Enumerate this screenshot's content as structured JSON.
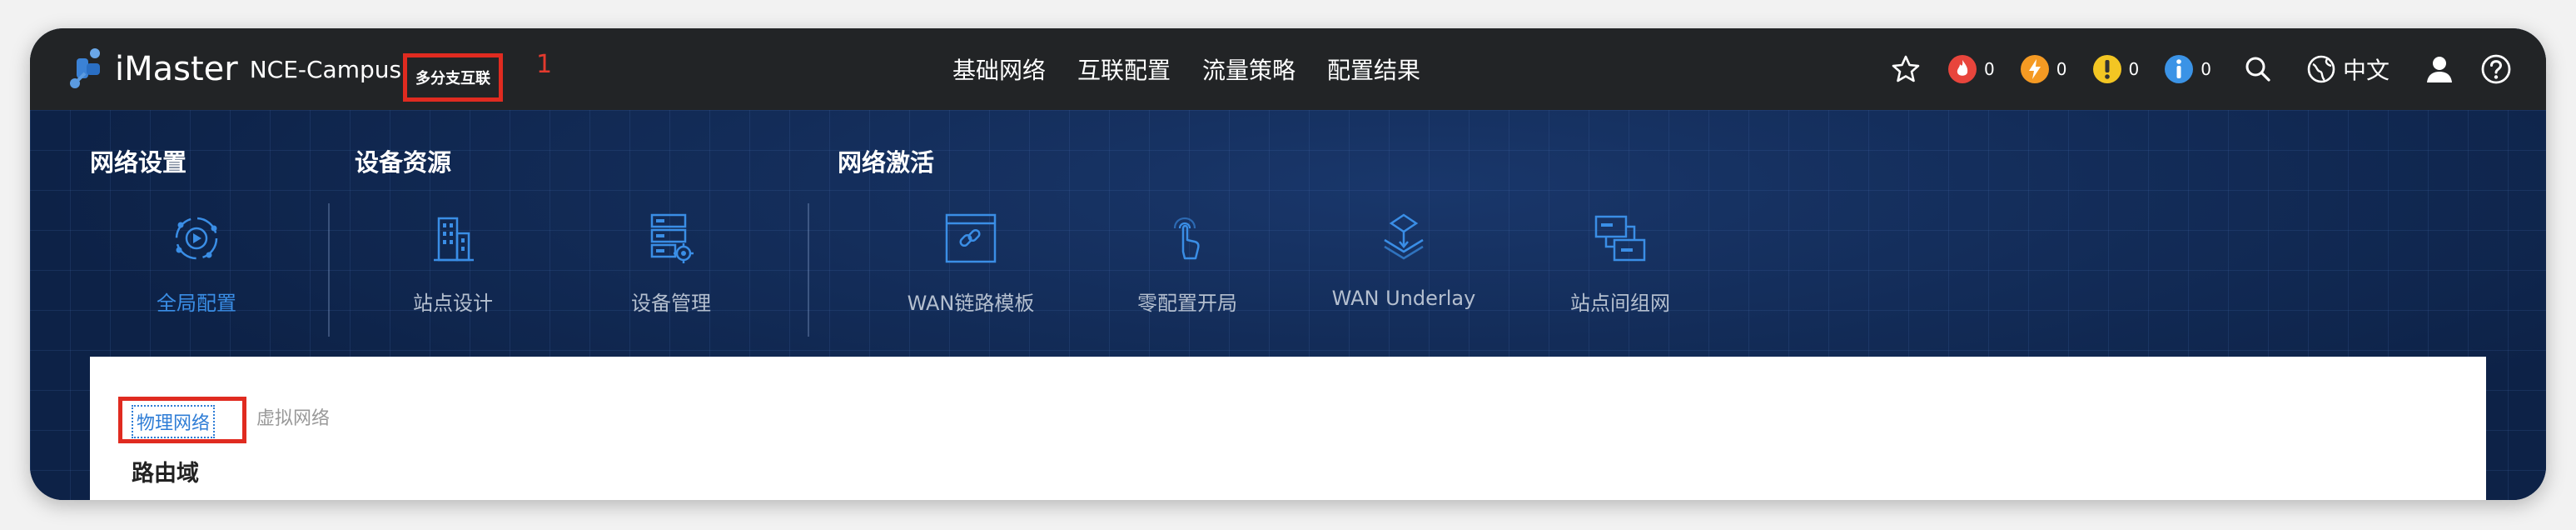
{
  "brand": {
    "product": "iMaster",
    "name": "NCE-Campus"
  },
  "scene_tag": "多分支互联",
  "annotation_number": "1",
  "nav": [
    "基础网络",
    "互联配置",
    "流量策略",
    "配置结果"
  ],
  "alerts": {
    "critical": {
      "count": "0",
      "color": "#e8453c"
    },
    "major": {
      "count": "0",
      "color": "#f59a23"
    },
    "minor": {
      "count": "0",
      "color": "#f3c623"
    },
    "info": {
      "count": "0",
      "color": "#3b93e6"
    }
  },
  "language": "中文",
  "groups": {
    "network_settings": "网络设置",
    "device_resources": "设备资源",
    "network_activation": "网络激活"
  },
  "modules": [
    {
      "label": "全局配置",
      "icon": "global-config-icon",
      "active": true
    },
    {
      "label": "站点设计",
      "icon": "building-icon",
      "active": false
    },
    {
      "label": "设备管理",
      "icon": "device-gear-icon",
      "active": false
    },
    {
      "label": "WAN链路模板",
      "icon": "link-template-icon",
      "active": false
    },
    {
      "label": "零配置开局",
      "icon": "touch-hand-icon",
      "active": false
    },
    {
      "label": "WAN Underlay",
      "icon": "underlay-icon",
      "active": false
    },
    {
      "label": "站点间组网",
      "icon": "site-network-icon",
      "active": false
    }
  ],
  "tabs": {
    "physical": "物理网络",
    "virtual": "虚拟网络"
  },
  "section_title": "路由域",
  "colors": {
    "accent": "#3a8ee6",
    "annotation_red": "#e02b20",
    "topbar": "#222426",
    "banner": "#0d2247"
  }
}
